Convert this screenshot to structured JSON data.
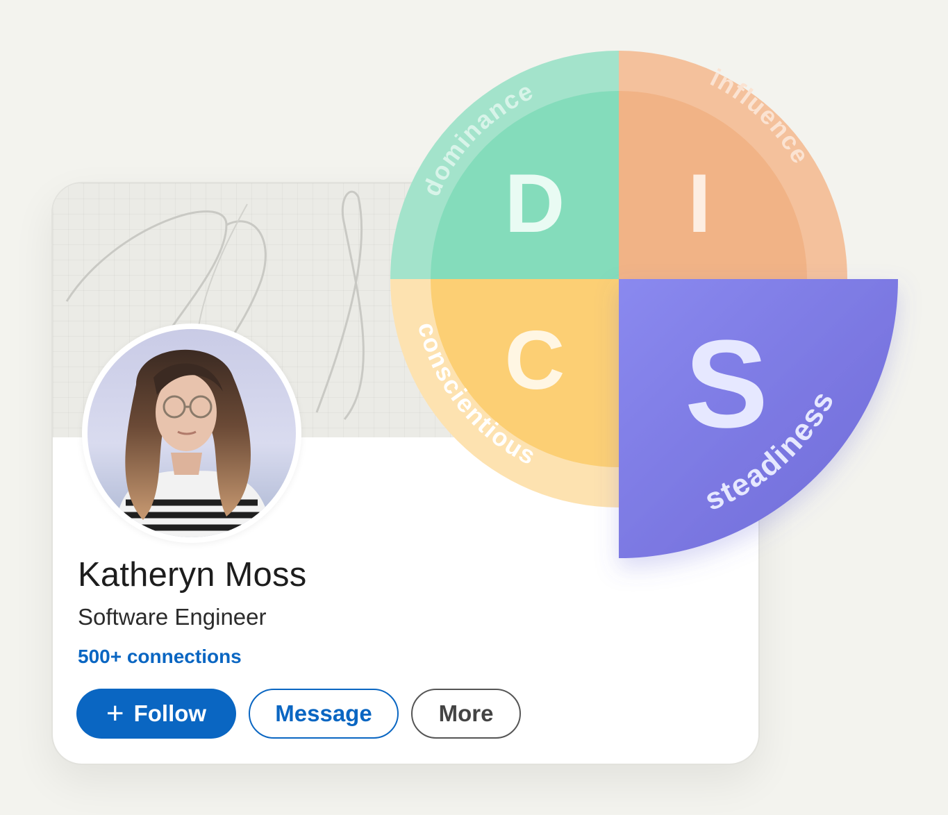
{
  "profile": {
    "name": "Katheryn Moss",
    "headline": "Software Engineer",
    "connections": "500+ connections",
    "avatar_icon": "profile-photo"
  },
  "actions": {
    "follow_icon": "plus-icon",
    "follow_plus": "+",
    "follow": "Follow",
    "message": "Message",
    "more": "More"
  },
  "disc": {
    "quadrants": [
      {
        "letter": "D",
        "word": "dominance",
        "color": "#84dcbb"
      },
      {
        "letter": "I",
        "word": "influence",
        "color": "#f1b386"
      },
      {
        "letter": "S",
        "word": "steadiness",
        "color": "#7f7ce4"
      },
      {
        "letter": "C",
        "word": "conscientious",
        "color": "#fccf74"
      }
    ],
    "highlighted": "S"
  },
  "colors": {
    "brand": "#0a66c2",
    "background": "#f3f3ee"
  }
}
